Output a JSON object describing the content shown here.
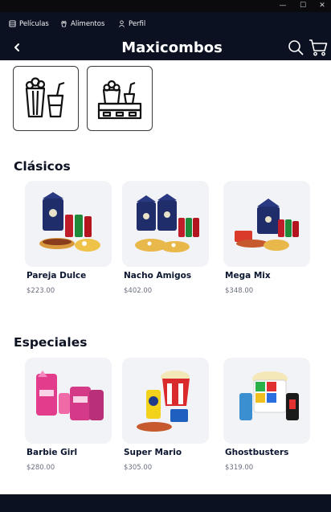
{
  "window": {
    "min_glyph": "—",
    "max_glyph": "☐",
    "close_glyph": "✕"
  },
  "nav": {
    "tabs": [
      {
        "label": "Películas",
        "icon": "film-icon"
      },
      {
        "label": "Alimentos",
        "icon": "food-icon",
        "active": true
      },
      {
        "label": "Perfil",
        "icon": "person-icon"
      }
    ],
    "accent": "#2bc4d8"
  },
  "header": {
    "title": "Maxicombos",
    "back_icon": "chevron-left-icon",
    "search_icon": "search-icon",
    "cart_icon": "cart-icon"
  },
  "categories": [
    {
      "icon": "popcorn-drink-icon"
    },
    {
      "icon": "combo-tray-icon"
    }
  ],
  "sections": [
    {
      "title": "Clásicos",
      "products": [
        {
          "name": "Pareja Dulce",
          "price": "$223.00"
        },
        {
          "name": "Nacho Amigos",
          "price": "$402.00"
        },
        {
          "name": "Mega Mix",
          "price": "$348.00"
        }
      ]
    },
    {
      "title": "Especiales",
      "products": [
        {
          "name": "Barbie Girl",
          "price": "$280.00"
        },
        {
          "name": "Super Mario",
          "price": "$305.00"
        },
        {
          "name": "Ghostbusters",
          "price": "$319.00"
        }
      ]
    }
  ],
  "colors": {
    "navy": "#0b1120",
    "card_bg": "#f2f3f6",
    "title": "#0c1222"
  }
}
